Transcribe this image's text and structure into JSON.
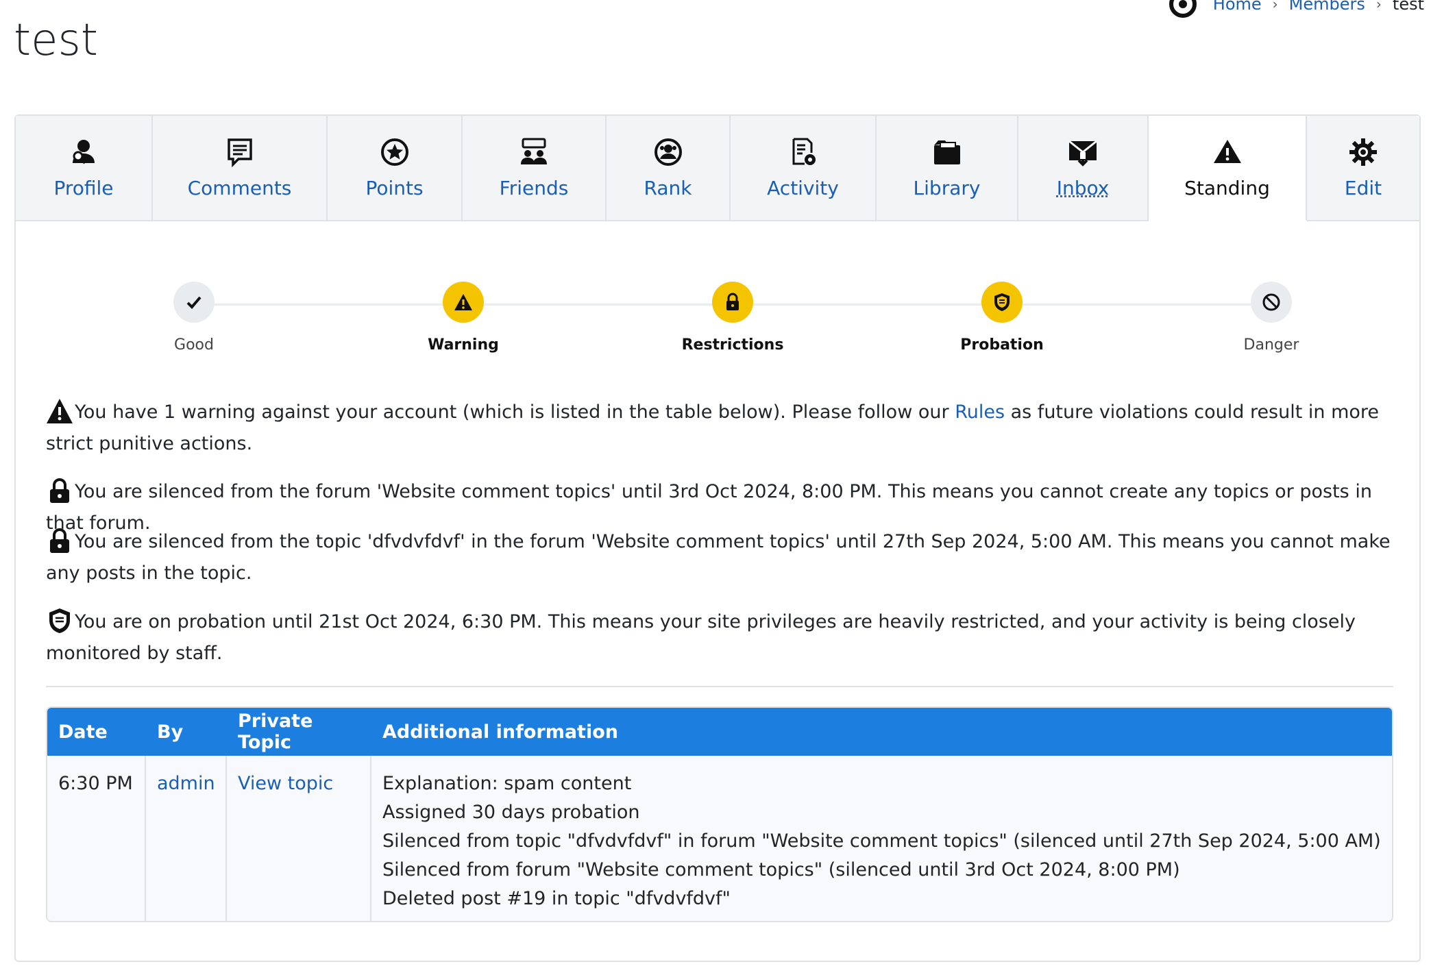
{
  "breadcrumb": {
    "home": "Home",
    "members": "Members",
    "current": "test"
  },
  "page_title": "test",
  "tabs": [
    {
      "label": "Profile",
      "icon": "profile-search-icon"
    },
    {
      "label": "Comments",
      "icon": "comment-icon"
    },
    {
      "label": "Points",
      "icon": "star-icon"
    },
    {
      "label": "Friends",
      "icon": "friends-icon"
    },
    {
      "label": "Rank",
      "icon": "rank-icon"
    },
    {
      "label": "Activity",
      "icon": "activity-icon"
    },
    {
      "label": "Library",
      "icon": "library-icon"
    },
    {
      "label": "Inbox",
      "icon": "inbox-icon"
    },
    {
      "label": "Standing",
      "icon": "warning-icon",
      "active": true
    },
    {
      "label": "Edit",
      "icon": "gear-icon"
    }
  ],
  "standing_steps": [
    {
      "label": "Good",
      "icon": "check-icon"
    },
    {
      "label": "Warning",
      "icon": "warning-icon"
    },
    {
      "label": "Restrictions",
      "icon": "lock-icon"
    },
    {
      "label": "Probation",
      "icon": "shield-icon"
    },
    {
      "label": "Danger",
      "icon": "ban-icon"
    }
  ],
  "messages": {
    "warning_pre": "You have 1 warning against your account (which is listed in the table below). Please follow our ",
    "warning_link": "Rules",
    "warning_post": " as future violations could result in more strict punitive actions.",
    "silenced_forum": "You are silenced from the forum 'Website comment topics' until 3rd Oct 2024, 8:00 PM. This means you cannot create any topics or posts in that forum.",
    "silenced_topic": "You are silenced from the topic 'dfvdvfdvf' in the forum 'Website comment topics' until 27th Sep 2024, 5:00 AM. This means you cannot make any posts in the topic.",
    "probation": "You are on probation until 21st Oct 2024, 6:30 PM. This means your site privileges are heavily restricted, and your activity is being closely monitored by staff."
  },
  "table": {
    "headers": [
      "Date",
      "By",
      "Private Topic",
      "Additional information"
    ],
    "row": {
      "date": "6:30 PM",
      "by": "admin",
      "topic": "View topic",
      "info": [
        "Explanation: spam content",
        "Assigned 30 days probation",
        "Silenced from topic \"dfvdvfdvf\" in forum \"Website comment topics\" (silenced until 27th Sep 2024, 5:00 AM)",
        "Silenced from forum \"Website comment topics\" (silenced until 3rd Oct 2024, 8:00 PM)",
        "Deleted post #19 in topic \"dfvdvfdvf\""
      ]
    }
  },
  "colors": {
    "accent": "#1c7fe0",
    "link": "#1a5fb4",
    "step_active": "#f5c400",
    "step_inactive": "#e9ecef"
  }
}
